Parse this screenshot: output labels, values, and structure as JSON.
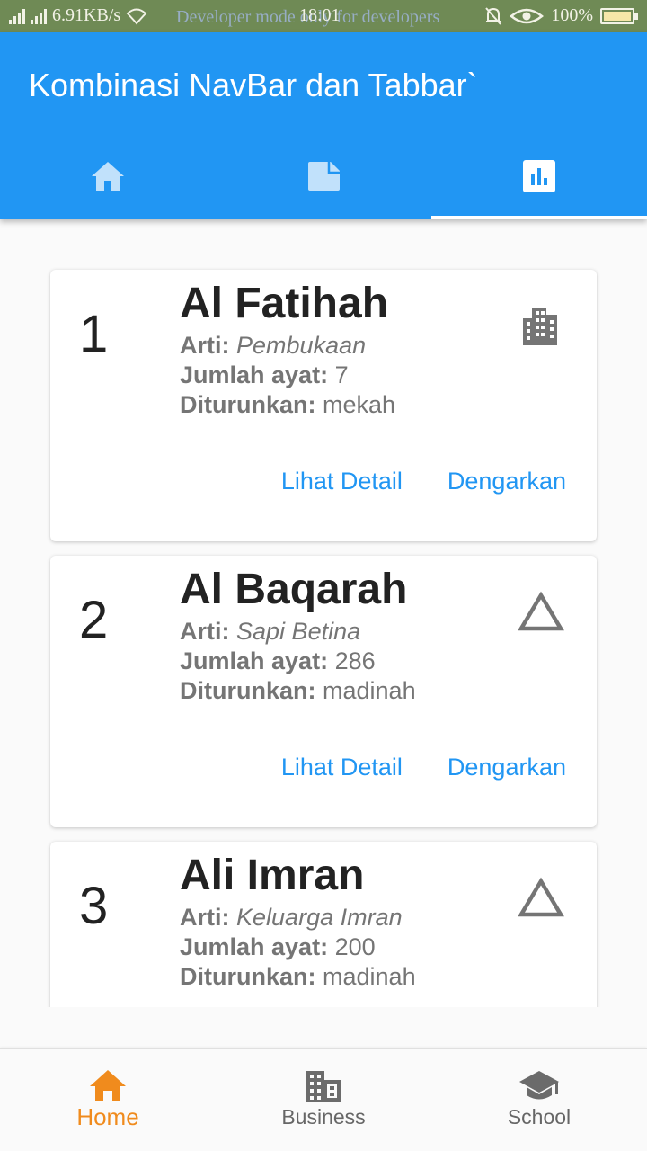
{
  "status_bar": {
    "speed": "6.91KB/s",
    "dev_notice": "Developer mode only for developers",
    "time": "18:01",
    "battery": "100%"
  },
  "app_bar": {
    "title": "Kombinasi NavBar dan Tabbar`",
    "tabs": [
      {
        "icon": "home-icon",
        "active": false
      },
      {
        "icon": "note-icon",
        "active": false
      },
      {
        "icon": "bar-chart-icon",
        "active": true
      }
    ]
  },
  "labels": {
    "arti": "Arti:",
    "jumlah_ayat": "Jumlah ayat:",
    "diturunkan": "Diturunkan:",
    "lihat_detail": "Lihat Detail",
    "dengarkan": "Dengarkan"
  },
  "surahs": [
    {
      "number": "1",
      "name": "Al Fatihah",
      "arti": "Pembukaan",
      "ayat": "7",
      "diturunkan": "mekah",
      "icon": "building-icon"
    },
    {
      "number": "2",
      "name": "Al Baqarah",
      "arti": "Sapi Betina",
      "ayat": "286",
      "diturunkan": "madinah",
      "icon": "triangle-icon"
    },
    {
      "number": "3",
      "name": "Ali Imran",
      "arti": "Keluarga Imran",
      "ayat": "200",
      "diturunkan": "madinah",
      "icon": "triangle-icon"
    }
  ],
  "bottom_nav": {
    "items": [
      {
        "label": "Home",
        "icon": "home-icon",
        "active": true
      },
      {
        "label": "Business",
        "icon": "business-icon",
        "active": false
      },
      {
        "label": "School",
        "icon": "school-icon",
        "active": false
      }
    ]
  },
  "colors": {
    "primary": "#2196f3",
    "accent_active": "#f08b1d",
    "status_bar": "#6f8a55"
  }
}
